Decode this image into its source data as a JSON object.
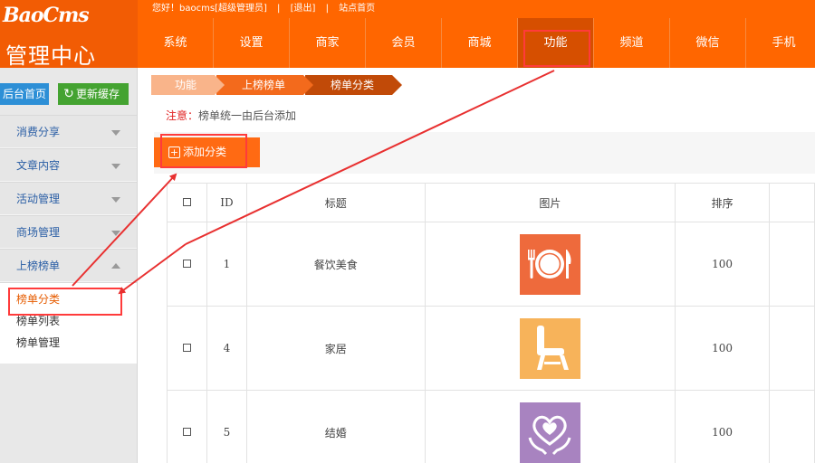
{
  "header": {
    "logo": "BaoCms",
    "center_title": "管理中心",
    "greeting": "您好！baocms[超级管理员]",
    "logout": "[退出]",
    "site_home": "站点首页",
    "separator": "|",
    "nav": [
      "系统",
      "设置",
      "商家",
      "会员",
      "商城",
      "功能",
      "频道",
      "微信",
      "手机"
    ],
    "active_nav": "功能",
    "accent": "#ff6600",
    "highlight": "#ff3b3b"
  },
  "sidebar": {
    "home_button": "后台首页",
    "cache_button": "更新缓存",
    "menus": [
      "消费分享",
      "文章内容",
      "活动管理",
      "商场管理",
      "上榜榜单"
    ],
    "submenu": [
      "榜单分类",
      "榜单列表",
      "榜单管理"
    ],
    "active_submenu": "榜单分类"
  },
  "main": {
    "breadcrumb": [
      "功能",
      "上榜榜单",
      "榜单分类"
    ],
    "notice_label": "注意：",
    "notice_text": "榜单统一由后台添加",
    "add_button": "添加分类",
    "table": {
      "headers": [
        "",
        "ID",
        "标题",
        "图片",
        "排序",
        ""
      ],
      "rows": [
        {
          "id": "1",
          "title": "餐饮美食",
          "icon": "dinner-plate-icon",
          "color": "#ee6a3c",
          "sort": "100"
        },
        {
          "id": "4",
          "title": "家居",
          "icon": "chair-icon",
          "color": "#f7b35a",
          "sort": "100"
        },
        {
          "id": "5",
          "title": "结婚",
          "icon": "heart-hands-icon",
          "color": "#a883c0",
          "sort": "100"
        }
      ]
    }
  }
}
